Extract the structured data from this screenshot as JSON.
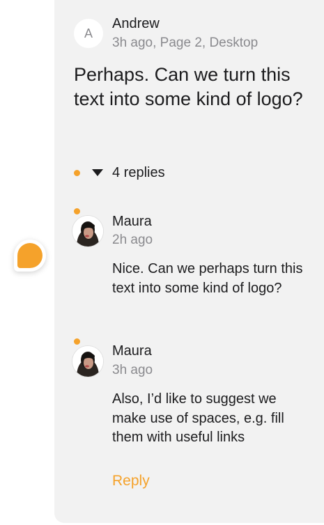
{
  "comment": {
    "avatar_letter": "A",
    "author": "Andrew",
    "meta": "3h ago, Page 2, Desktop",
    "text": "Perhaps. Can we turn this text into some kind of logo?"
  },
  "thread": {
    "replies_label": "4 replies"
  },
  "replies": [
    {
      "author": "Maura",
      "time": "2h ago",
      "text": "Nice. Can we perhaps turn this text into some kind of logo?"
    },
    {
      "author": "Maura",
      "time": "3h ago",
      "text": "Also, I’d like to suggest we make use of spaces, e.g. fill them with useful links"
    }
  ],
  "actions": {
    "reply_label": "Reply"
  },
  "colors": {
    "accent": "#f5a22b",
    "panel_bg": "#f2f2f2",
    "text": "#1c1c1e",
    "muted": "#8a8a8e"
  }
}
